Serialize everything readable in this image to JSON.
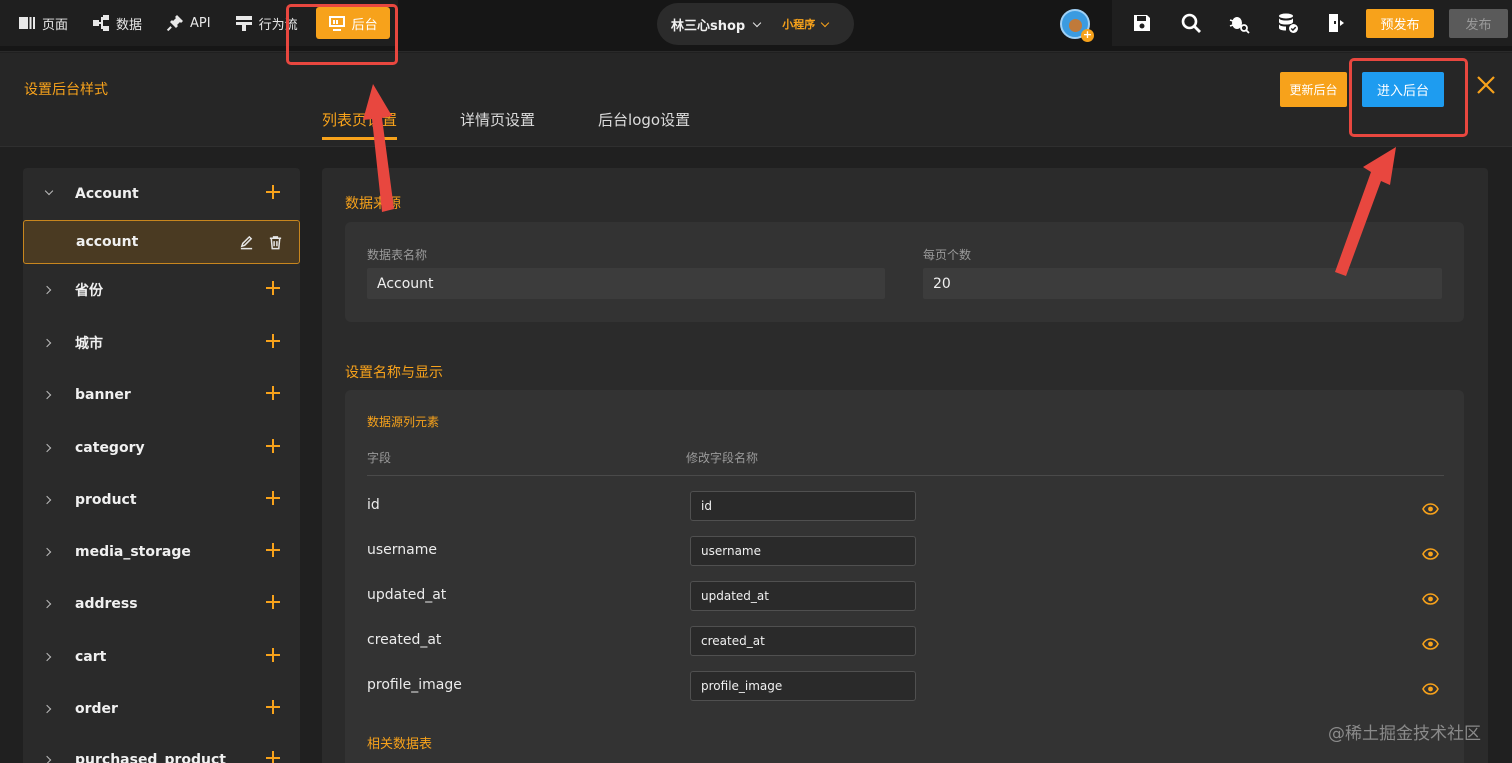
{
  "topnav": {
    "items": [
      {
        "label": "页面",
        "icon": "pages-icon"
      },
      {
        "label": "数据",
        "icon": "data-icon"
      },
      {
        "label": "API",
        "icon": "api-icon"
      },
      {
        "label": "行为流",
        "icon": "flow-icon"
      },
      {
        "label": "后台",
        "icon": "admin-icon",
        "active": true
      }
    ]
  },
  "project": {
    "name": "林三心shop",
    "platform": "小程序"
  },
  "toolbar": {
    "prepublish_label": "预发布",
    "publish_label": "发布"
  },
  "panel": {
    "title": "设置后台样式",
    "tabs": [
      "列表页设置",
      "详情页设置",
      "后台logo设置"
    ],
    "update_label": "更新后台",
    "enter_label": "进入后台"
  },
  "tables": [
    {
      "name": "Account",
      "expanded": true
    },
    {
      "name": "account",
      "child": true
    },
    {
      "name": "省份"
    },
    {
      "name": "城市"
    },
    {
      "name": "banner"
    },
    {
      "name": "category"
    },
    {
      "name": "product"
    },
    {
      "name": "media_storage"
    },
    {
      "name": "address"
    },
    {
      "name": "cart"
    },
    {
      "name": "order"
    },
    {
      "name": "purchased_product"
    }
  ],
  "data_source": {
    "section_title": "数据来源",
    "table_name_label": "数据表名称",
    "table_name_value": "Account",
    "page_size_label": "每页个数",
    "page_size_value": "20"
  },
  "display": {
    "section_title": "设置名称与显示",
    "subhead": "数据源列元素",
    "col_field": "字段",
    "col_rename": "修改字段名称",
    "rows": [
      {
        "field": "id",
        "rename": "id"
      },
      {
        "field": "username",
        "rename": "username"
      },
      {
        "field": "updated_at",
        "rename": "updated_at"
      },
      {
        "field": "created_at",
        "rename": "created_at"
      },
      {
        "field": "profile_image",
        "rename": "profile_image"
      }
    ],
    "related_title": "相关数据表"
  },
  "colors": {
    "accent": "#f7a21b",
    "primary": "#1e9cf0",
    "annotation": "#e8473f"
  },
  "watermark": "@稀土掘金技术社区"
}
